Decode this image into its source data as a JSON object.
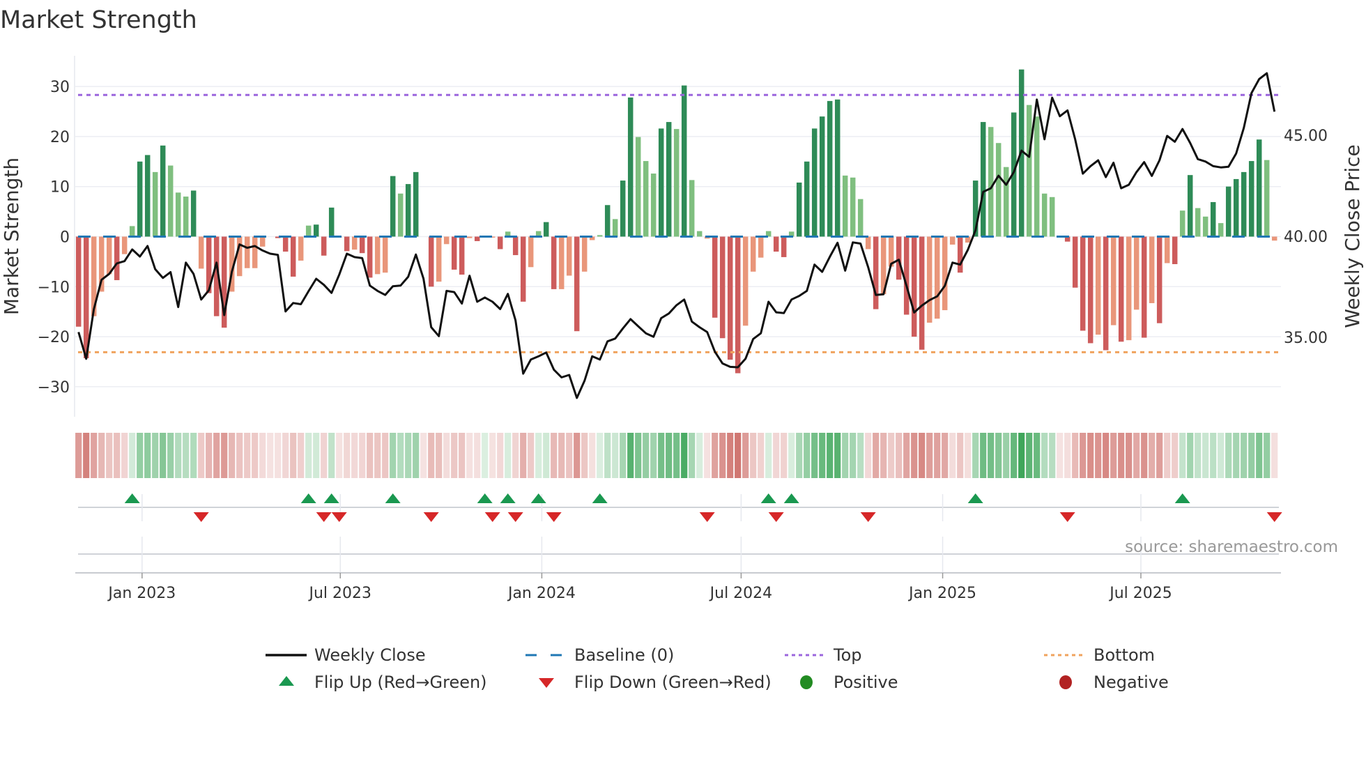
{
  "chart_data": {
    "type": "bar",
    "title": "Market Strength",
    "ylabel": "Market Strength",
    "y2label": "Weekly Close Price",
    "ylim": [
      -36,
      36
    ],
    "y2lim": [
      31.07,
      48.9
    ],
    "yticks": [
      30,
      20,
      10,
      0,
      -10,
      -20,
      -30
    ],
    "ytick_labels": [
      "30",
      "20",
      "10",
      "0",
      "−10",
      "−20",
      "−30"
    ],
    "y2ticks": [
      35,
      40,
      45
    ],
    "y2tick_labels": [
      "35.00",
      "40.00",
      "45.00"
    ],
    "grid": true,
    "start_date": "2022-11-04",
    "interval": "weekly",
    "xticks": [
      {
        "date": "2023-01-01",
        "label": "Jan 2023"
      },
      {
        "date": "2023-07-01",
        "label": "Jul 2023"
      },
      {
        "date": "2024-01-01",
        "label": "Jan 2024"
      },
      {
        "date": "2024-07-01",
        "label": "Jul 2024"
      },
      {
        "date": "2025-01-01",
        "label": "Jan 2025"
      },
      {
        "date": "2025-07-01",
        "label": "Jul 2025"
      }
    ],
    "reference_lines": {
      "baseline": 0,
      "top": 28.3,
      "bottom": -23.1
    },
    "strength": [
      -18,
      -24.3,
      -15.9,
      -11,
      -7.5,
      -8.7,
      -3.5,
      2.1,
      15,
      16.3,
      12.9,
      18.2,
      14.2,
      8.8,
      8,
      9.2,
      -6.4,
      -11.3,
      -15.9,
      -18.2,
      -11,
      -7.9,
      -6.3,
      -6.3,
      -2,
      0,
      -0.3,
      -3,
      -8,
      -4.8,
      2.2,
      2.4,
      -3.8,
      5.8,
      -0.2,
      -2.9,
      -2.6,
      -3.3,
      -8.2,
      -7.5,
      -7.2,
      12.1,
      8.6,
      10.5,
      12.9,
      0,
      -10,
      -9,
      -1.5,
      -6.6,
      -7.6,
      -0.3,
      -0.9,
      0.2,
      -0.2,
      -2.5,
      1,
      -3.7,
      -13,
      -6.1,
      1.1,
      2.9,
      -10.5,
      -10.5,
      -7.8,
      -18.9,
      -7,
      -0.7,
      0.3,
      6.3,
      3.5,
      11.2,
      27.8,
      19.9,
      15.1,
      12.6,
      21.6,
      22.9,
      21.5,
      30.2,
      11.3,
      1.1,
      -0.4,
      -16.2,
      -20.3,
      -24.6,
      -27.3,
      -17.8,
      -7,
      -4.2,
      1.1,
      -3,
      -4.1,
      1,
      10.8,
      15,
      21.6,
      24,
      27.1,
      27.4,
      12.2,
      11.8,
      7.5,
      -2.5,
      -14.5,
      -11.5,
      -6,
      -8.6,
      -15.6,
      -20,
      -22.6,
      -17.2,
      -16.4,
      -14.7,
      -1.6,
      -7.2,
      -1.2,
      11.2,
      22.9,
      21.9,
      18.7,
      13.9,
      24.8,
      33.4,
      26.3,
      24,
      8.6,
      7.9,
      0,
      -1,
      -10.2,
      -18.8,
      -21.3,
      -19.6,
      -22.7,
      -17.7,
      -21,
      -20.7,
      -14.6,
      -20.2,
      -13.3,
      -17.3,
      -5.3,
      -5.5,
      5.2,
      12.3,
      5.7,
      4,
      6.9,
      2.7,
      10,
      11.5,
      12.9,
      15.1,
      19.4,
      15.3,
      -0.8
    ],
    "weekly_close": [
      35.26,
      33.94,
      36.4,
      37.85,
      38.14,
      38.66,
      38.77,
      39.35,
      39.0,
      39.52,
      38.37,
      37.94,
      38.23,
      36.5,
      38.7,
      38.14,
      36.87,
      37.33,
      38.7,
      36.1,
      38.25,
      39.6,
      39.43,
      39.52,
      39.3,
      39.14,
      39.08,
      36.28,
      36.7,
      36.64,
      37.28,
      37.9,
      37.6,
      37.2,
      38.1,
      39.14,
      38.97,
      38.92,
      37.56,
      37.3,
      37.1,
      37.53,
      37.56,
      38.0,
      39.1,
      37.9,
      35.5,
      35.06,
      37.3,
      37.24,
      36.67,
      38.05,
      36.76,
      36.97,
      36.76,
      36.4,
      37.15,
      35.84,
      33.2,
      33.9,
      34.06,
      34.25,
      33.4,
      33.02,
      33.14,
      32.0,
      32.85,
      34.06,
      33.9,
      34.8,
      34.94,
      35.44,
      35.9,
      35.55,
      35.2,
      35.03,
      35.95,
      36.18,
      36.59,
      36.87,
      35.78,
      35.5,
      35.26,
      34.29,
      33.71,
      33.54,
      33.52,
      33.94,
      34.92,
      35.2,
      36.76,
      36.24,
      36.2,
      36.87,
      37.05,
      37.3,
      38.6,
      38.24,
      38.99,
      39.68,
      38.3,
      39.7,
      39.64,
      38.47,
      37.1,
      37.13,
      38.64,
      38.84,
      37.55,
      36.23,
      36.57,
      36.84,
      37.03,
      37.55,
      38.7,
      38.6,
      39.33,
      40.3,
      42.2,
      42.38,
      43.0,
      42.55,
      43.18,
      44.24,
      43.93,
      46.77,
      44.8,
      46.86,
      45.94,
      46.23,
      44.8,
      43.1,
      43.47,
      43.76,
      42.93,
      43.64,
      42.38,
      42.55,
      43.18,
      43.67,
      42.99,
      43.76,
      44.97,
      44.68,
      45.31,
      44.62,
      43.82,
      43.7,
      43.47,
      43.41,
      43.44,
      44.1,
      45.37,
      47.09,
      47.78,
      48.07,
      46.17
    ],
    "flip_up_weeks": [
      8,
      31,
      34,
      42,
      54,
      57,
      61,
      69,
      91,
      94,
      118,
      145
    ],
    "flip_down_weeks": [
      17,
      33,
      35,
      47,
      55,
      58,
      63,
      83,
      92,
      104,
      130,
      157
    ],
    "legend": {
      "placement": "bottom",
      "items": [
        {
          "label": "Weekly Close",
          "symbol": "line"
        },
        {
          "label": "Baseline (0)",
          "symbol": "dash"
        },
        {
          "label": "Top",
          "symbol": "dot"
        },
        {
          "label": "Bottom",
          "symbol": "dot"
        },
        {
          "label": "Flip Up (Red→Green)",
          "symbol": "triangle-up"
        },
        {
          "label": "Flip Down (Green→Red)",
          "symbol": "triangle-down"
        },
        {
          "label": "Positive",
          "symbol": "circle"
        },
        {
          "label": "Negative",
          "symbol": "circle"
        }
      ]
    },
    "source": "source: sharemaestro.com"
  },
  "colors": {
    "pos_strong": "#2e8b57",
    "pos_weak": "#7fbf7f",
    "neg_strong": "#cd5c5c",
    "neg_weak": "#e9967a",
    "price": "#111111",
    "baseline": "#1f77b4",
    "top": "#9b66dd",
    "bottom": "#f0a35e",
    "flip_up": "#1a9850",
    "flip_down": "#d62728",
    "positive": "#228b22",
    "negative": "#b22222",
    "grid": "#eceef3"
  }
}
